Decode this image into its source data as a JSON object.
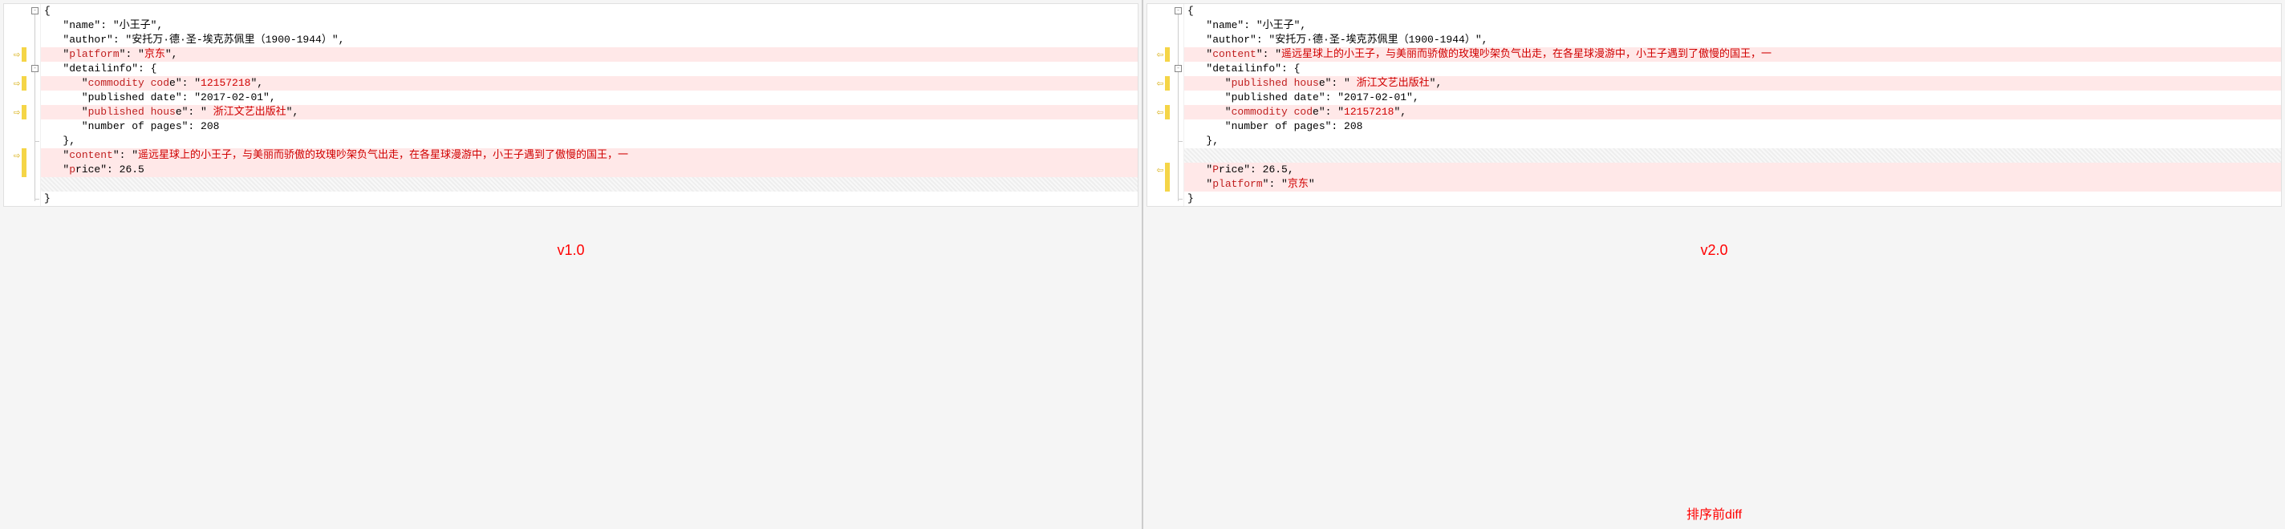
{
  "left": {
    "lines": [
      {
        "diff": false,
        "mark": "",
        "t": "{"
      },
      {
        "diff": false,
        "mark": "",
        "t": "   \"name\": \"小王子\","
      },
      {
        "diff": false,
        "mark": "",
        "t": "   \"author\": \"安托万·德·圣-埃克苏佩里（1900-1944）\","
      },
      {
        "diff": true,
        "mark": "right",
        "pre": "   \"",
        "key": "platform",
        "mid": "\": \"",
        "val": "京东",
        "post": "\","
      },
      {
        "diff": false,
        "mark": "",
        "t": "   \"detailinfo\": {"
      },
      {
        "diff": true,
        "mark": "right",
        "pre": "      \"",
        "key": "commodity cod",
        "keytail": "e\": \"",
        "val": "12157218",
        "post": "\","
      },
      {
        "diff": false,
        "mark": "",
        "t": "      \"published date\": \"2017-02-01\","
      },
      {
        "diff": true,
        "mark": "right",
        "pre": "      \"",
        "key": "published hous",
        "keytail": "e\": \" ",
        "val": "浙江文艺出版社",
        "post": "\","
      },
      {
        "diff": false,
        "mark": "",
        "t": "      \"number of pages\": 208"
      },
      {
        "diff": false,
        "mark": "",
        "t": "   },"
      },
      {
        "diff": true,
        "mark": "right",
        "pre": "   \"",
        "key": "content",
        "keytail": "\": \"",
        "val": "遥远星球上的小王子，与美丽而骄傲的玫瑰吵架负气出走，在各星球漫游中，小王子遇到了傲慢的国王，一",
        "post": ""
      },
      {
        "diff": true,
        "mark": "",
        "pre": "   \"",
        "key": "p",
        "keytail": "rice\": ",
        "valplain": "26.5",
        "post": ""
      },
      {
        "diff": false,
        "mark": "",
        "empty": true
      },
      {
        "diff": false,
        "mark": "",
        "t": "}"
      }
    ],
    "version": "v1.0"
  },
  "right": {
    "lines": [
      {
        "diff": false,
        "mark": "",
        "t": "{"
      },
      {
        "diff": false,
        "mark": "",
        "t": "   \"name\": \"小王子\","
      },
      {
        "diff": false,
        "mark": "",
        "t": "   \"author\": \"安托万·德·圣-埃克苏佩里（1900-1944）\","
      },
      {
        "diff": true,
        "mark": "left",
        "pre": "   \"",
        "key": "content",
        "keytail": "\": \"",
        "val": "遥远星球上的小王子，与美丽而骄傲的玫瑰吵架负气出走，在各星球漫游中，小王子遇到了傲慢的国王，一",
        "post": ""
      },
      {
        "diff": false,
        "mark": "",
        "t": "   \"detailinfo\": {"
      },
      {
        "diff": true,
        "mark": "left",
        "pre": "      \"",
        "key": "published hous",
        "keytail": "e\": \" ",
        "val": "浙江文艺出版社",
        "post": "\","
      },
      {
        "diff": false,
        "mark": "",
        "t": "      \"published date\": \"2017-02-01\","
      },
      {
        "diff": true,
        "mark": "left",
        "pre": "      \"",
        "key": "commodity cod",
        "keytail": "e\": \"",
        "val": "12157218",
        "post": "\","
      },
      {
        "diff": false,
        "mark": "",
        "t": "      \"number of pages\": 208"
      },
      {
        "diff": false,
        "mark": "",
        "t": "   },"
      },
      {
        "diff": false,
        "mark": "",
        "empty": true
      },
      {
        "diff": true,
        "mark": "left",
        "pre": "   \"",
        "key": "P",
        "keytail": "rice\": ",
        "valplain": "26.5",
        "post": ","
      },
      {
        "diff": true,
        "mark": "",
        "pre": "   \"",
        "key": "platform",
        "keytail": "\": \"",
        "val": "京东",
        "post": "\""
      },
      {
        "diff": false,
        "mark": "",
        "t": "}"
      }
    ],
    "version": "v2.0"
  },
  "footer": "排序前diff"
}
